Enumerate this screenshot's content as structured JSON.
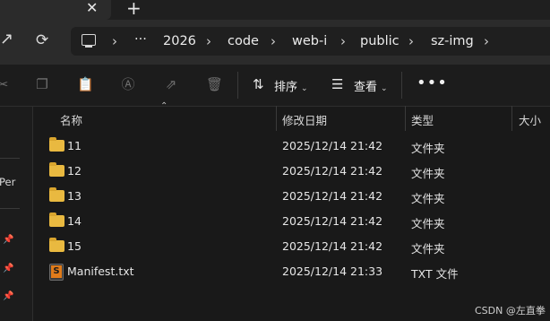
{
  "tabs": {
    "close_glyph": "✕",
    "new_tab_glyph": "+"
  },
  "address": {
    "overflow_glyph": "···",
    "breadcrumbs": [
      "2026",
      "code",
      "web-i",
      "public",
      "sz-img"
    ],
    "separator_glyph": "›"
  },
  "toolbar": {
    "sort_label": "排序",
    "view_label": "查看",
    "more_glyph": "•••"
  },
  "nav": {
    "partial_label": "Per",
    "pin_glyph": "📌"
  },
  "columns": {
    "name": "名称",
    "modified": "修改日期",
    "type": "类型",
    "size": "大小"
  },
  "files": [
    {
      "name": "11",
      "modified": "2025/12/14 21:42",
      "type": "文件夹",
      "kind": "folder"
    },
    {
      "name": "12",
      "modified": "2025/12/14 21:42",
      "type": "文件夹",
      "kind": "folder"
    },
    {
      "name": "13",
      "modified": "2025/12/14 21:42",
      "type": "文件夹",
      "kind": "folder"
    },
    {
      "name": "14",
      "modified": "2025/12/14 21:42",
      "type": "文件夹",
      "kind": "folder"
    },
    {
      "name": "15",
      "modified": "2025/12/14 21:42",
      "type": "文件夹",
      "kind": "folder"
    },
    {
      "name": "Manifest.txt",
      "modified": "2025/12/14 21:33",
      "type": "TXT 文件",
      "kind": "sublime-text-file"
    }
  ],
  "watermark": "CSDN @左直拳",
  "colors": {
    "folder": "#e9b940",
    "background": "#191919",
    "toolbar": "#1c1c1c"
  }
}
